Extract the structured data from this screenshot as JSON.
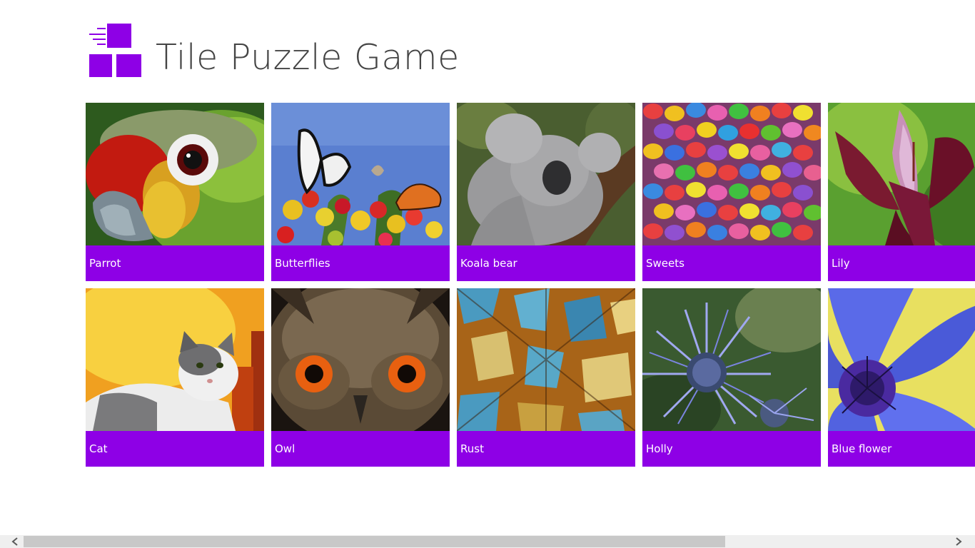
{
  "app": {
    "title": "Tile Puzzle Game",
    "accent_color": "#8e00e6",
    "logo_icon": "tile-puzzle-logo-icon"
  },
  "puzzles": [
    {
      "label": "Parrot"
    },
    {
      "label": "Butterflies"
    },
    {
      "label": "Koala bear"
    },
    {
      "label": "Sweets"
    },
    {
      "label": "Lily"
    },
    {
      "label": "Cat"
    },
    {
      "label": "Owl"
    },
    {
      "label": "Rust"
    },
    {
      "label": "Holly"
    },
    {
      "label": "Blue flower"
    }
  ],
  "scrollbar": {
    "left_icon": "chevron-left-icon",
    "right_icon": "chevron-right-icon"
  }
}
